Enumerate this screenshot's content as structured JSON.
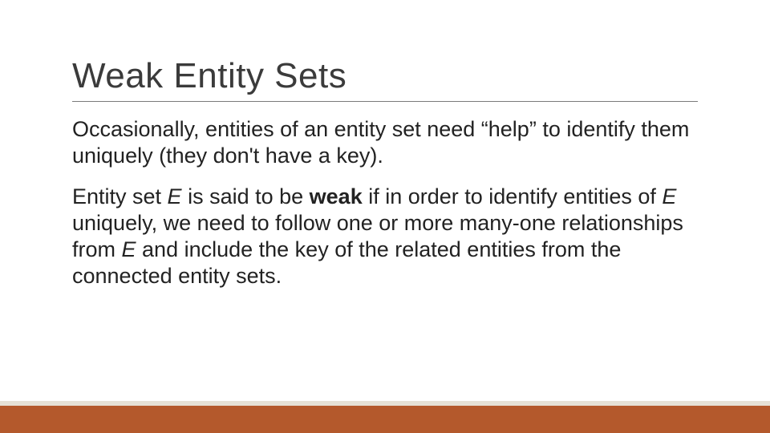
{
  "slide": {
    "title": "Weak Entity Sets",
    "para1": "Occasionally, entities of an entity set need “help” to identify them uniquely (they don't have a key).",
    "para2_pre": "Entity set ",
    "para2_e1": "E",
    "para2_mid1": "  is said to be ",
    "para2_weak": "weak",
    "para2_mid2": " if in order to identify entities of ",
    "para2_e2": "E",
    "para2_mid3": " uniquely, we need to follow one or more many-one relationships from ",
    "para2_e3": "E",
    "para2_post": " and include the key of the related entities from the connected entity sets."
  },
  "colors": {
    "accent": "#b4592c",
    "accent_light": "#e6e1d6"
  }
}
